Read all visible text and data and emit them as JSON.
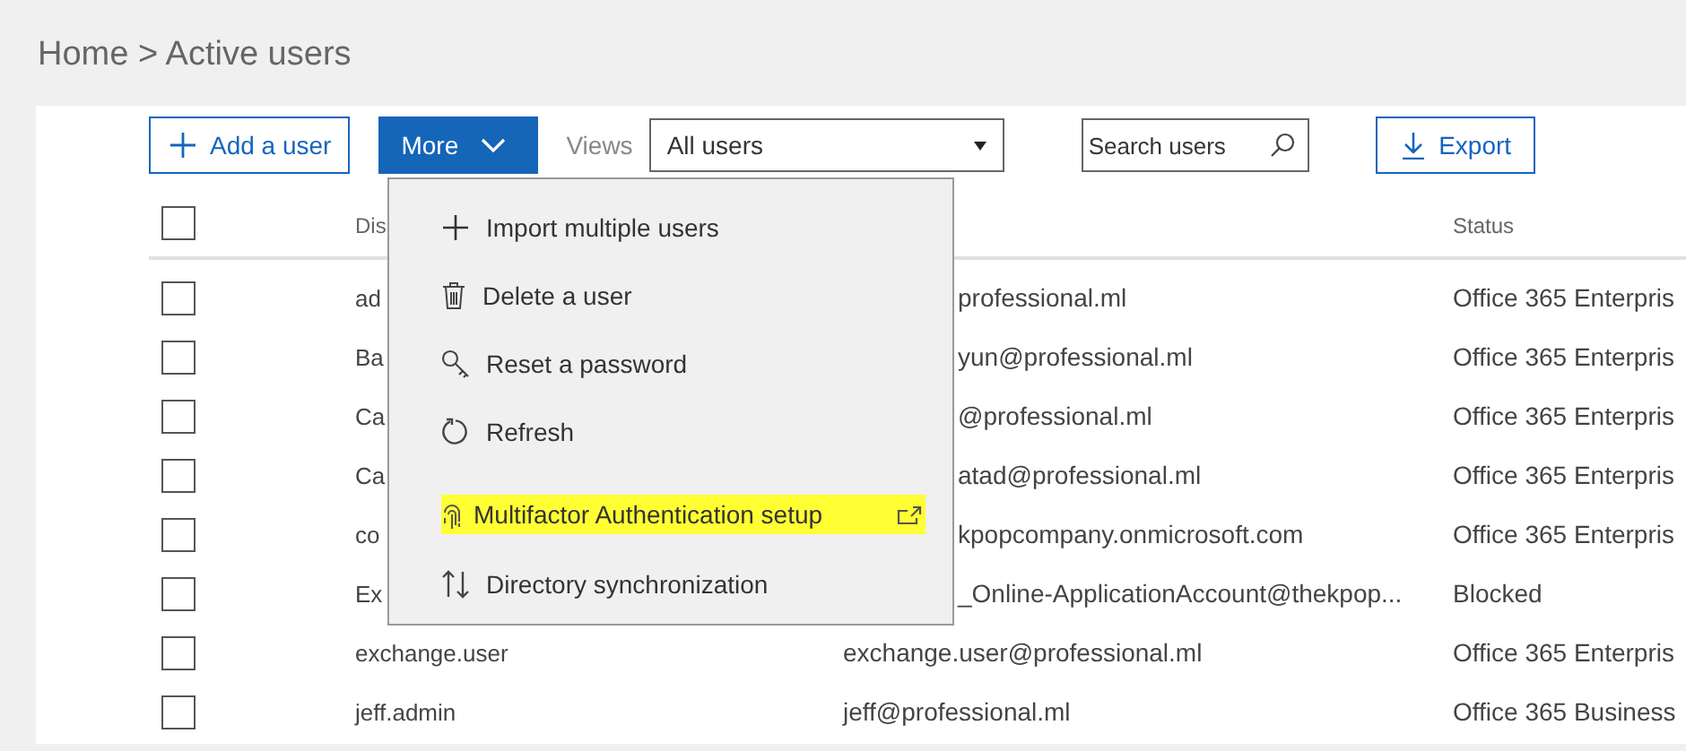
{
  "breadcrumb": "Home > Active users",
  "toolbar": {
    "add_user": "Add a user",
    "more": "More",
    "views_label": "Views",
    "views_value": "All users",
    "search": {
      "placeholder": "Search users"
    },
    "export": "Export"
  },
  "table": {
    "select_all_checked": false,
    "columns": [
      {
        "label": "Dis"
      },
      {
        "label": "Status"
      }
    ],
    "rows": [
      {
        "checked": false,
        "display": "ad",
        "username": "professional.ml",
        "username_covered": true,
        "status": "Office 365 Enterpris"
      },
      {
        "checked": false,
        "display": "Ba",
        "username": "yun@professional.ml",
        "username_covered": true,
        "status": "Office 365 Enterpris"
      },
      {
        "checked": false,
        "display": "Ca",
        "username": "@professional.ml",
        "username_covered": true,
        "status": "Office 365 Enterpris"
      },
      {
        "checked": false,
        "display": "Ca",
        "username": "atad@professional.ml",
        "username_covered": true,
        "status": "Office 365 Enterpris"
      },
      {
        "checked": false,
        "display": "co",
        "username": "kpopcompany.onmicrosoft.com",
        "username_covered": true,
        "status": "Office 365 Enterpris"
      },
      {
        "checked": false,
        "display": "Ex",
        "username": "_Online-ApplicationAccount@thekpop...",
        "username_covered": true,
        "status": "Blocked"
      },
      {
        "checked": false,
        "display": "exchange.user",
        "username": "exchange.user@professional.ml",
        "username_covered": false,
        "status": "Office 365 Enterpris"
      },
      {
        "checked": false,
        "display": "jeff.admin",
        "username": "jeff@professional.ml",
        "username_covered": false,
        "status": "Office 365 Business"
      }
    ]
  },
  "menu": {
    "items": [
      {
        "kind": "plus",
        "label": "Import multiple users",
        "highlighted": false,
        "external": false
      },
      {
        "kind": "trash",
        "label": "Delete a user",
        "highlighted": false,
        "external": false
      },
      {
        "kind": "key",
        "label": "Reset a password",
        "highlighted": false,
        "external": false
      },
      {
        "kind": "refresh",
        "label": "Refresh",
        "highlighted": false,
        "external": false
      },
      {
        "kind": "fingerprint",
        "label": "Multifactor Authentication setup",
        "highlighted": true,
        "external": true
      },
      {
        "kind": "sync",
        "label": "Directory synchronization",
        "highlighted": false,
        "external": false
      }
    ]
  }
}
